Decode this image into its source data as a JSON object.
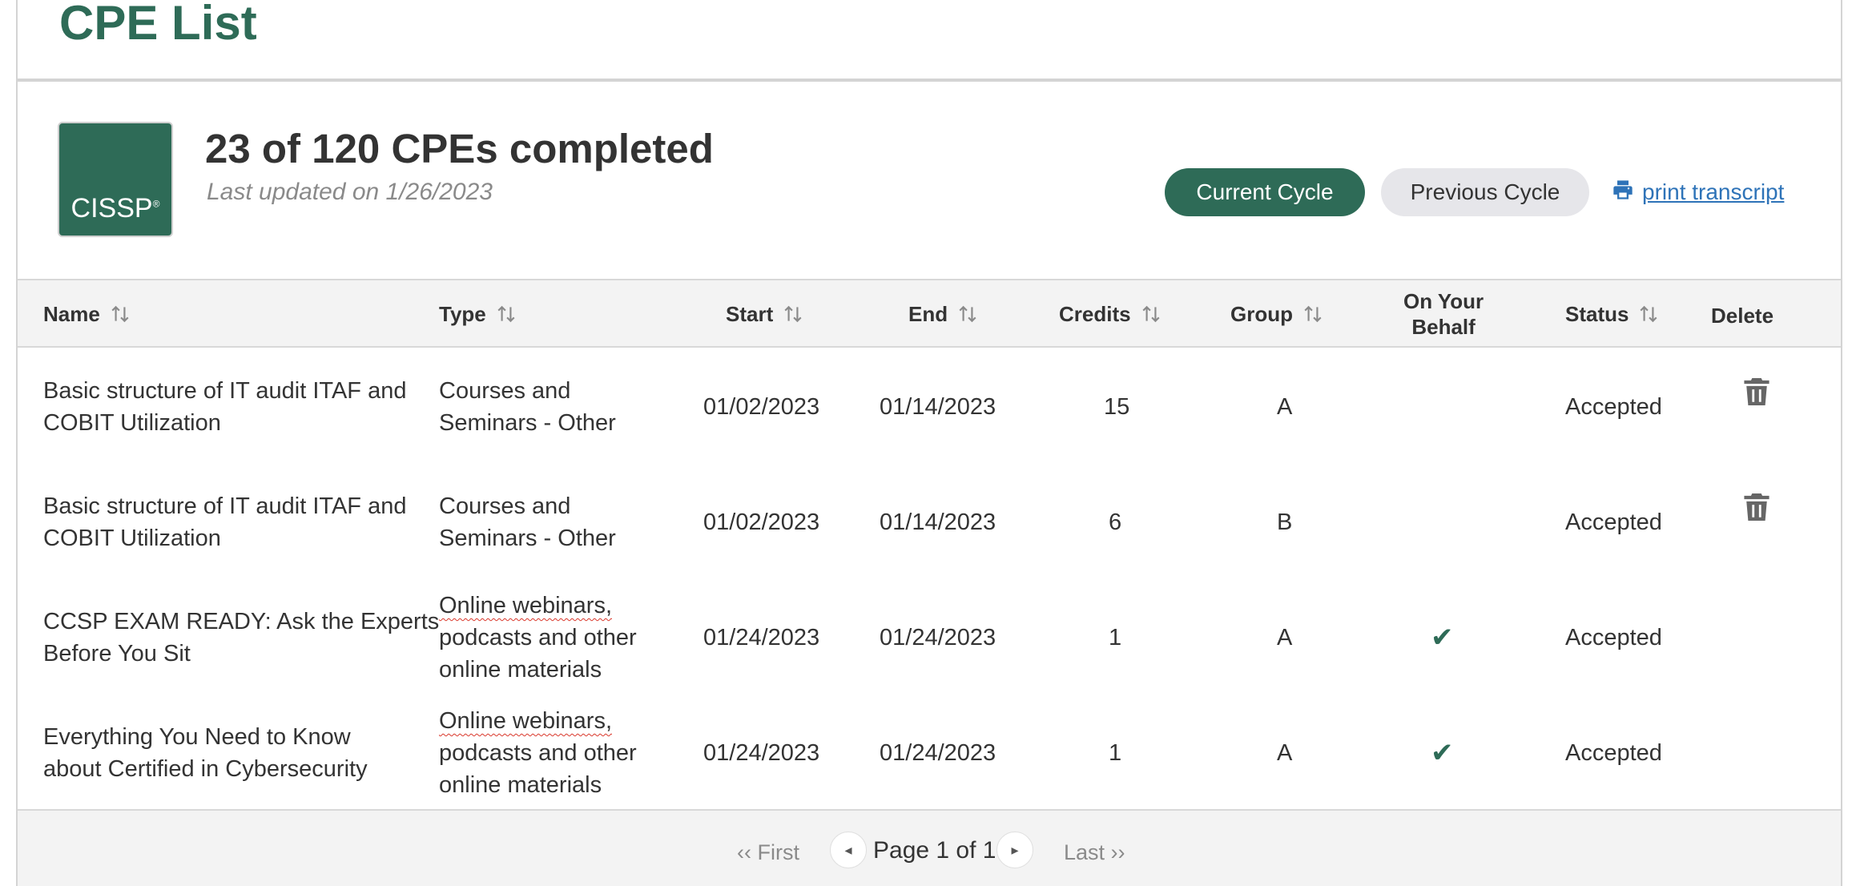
{
  "page": {
    "title": "CPE List"
  },
  "summary": {
    "logo_text": "CISSP",
    "logo_mark": "®",
    "title": "23 of 120 CPEs completed",
    "updated": "Last updated on 1/26/2023"
  },
  "actions": {
    "current_cycle": "Current Cycle",
    "previous_cycle": "Previous Cycle",
    "print_transcript": "print transcript"
  },
  "table": {
    "headers": {
      "name": "Name",
      "type": "Type",
      "start": "Start",
      "end": "End",
      "credits": "Credits",
      "group": "Group",
      "on_your_behalf_1": "On Your",
      "on_your_behalf_2": "Behalf",
      "status": "Status",
      "delete": "Delete"
    },
    "rows": [
      {
        "name_1": "Basic structure of IT audit ITAF and",
        "name_2": "COBIT Utilization",
        "type_1": "Courses and",
        "type_2": "Seminars - Other",
        "type_3": "",
        "start": "01/02/2023",
        "end": "01/14/2023",
        "credits": "15",
        "group": "A",
        "on_your_behalf": "",
        "status": "Accepted",
        "deletable": true
      },
      {
        "name_1": "Basic structure of IT audit ITAF and",
        "name_2": "COBIT Utilization",
        "type_1": "Courses and",
        "type_2": "Seminars - Other",
        "type_3": "",
        "start": "01/02/2023",
        "end": "01/14/2023",
        "credits": "6",
        "group": "B",
        "on_your_behalf": "",
        "status": "Accepted",
        "deletable": true
      },
      {
        "name_1": "CCSP EXAM READY: Ask the Experts",
        "name_2": "Before You Sit",
        "type_1": "Online webinars,",
        "type_2": "podcasts and other",
        "type_3": "online materials",
        "start": "01/24/2023",
        "end": "01/24/2023",
        "credits": "1",
        "group": "A",
        "on_your_behalf": "✔",
        "status": "Accepted",
        "deletable": false
      },
      {
        "name_1": "Everything You Need to Know",
        "name_2": "about Certified in Cybersecurity",
        "type_1": "Online webinars,",
        "type_2": "podcasts and other",
        "type_3": "online materials",
        "start": "01/24/2023",
        "end": "01/24/2023",
        "credits": "1",
        "group": "A",
        "on_your_behalf": "✔",
        "status": "Accepted",
        "deletable": false
      }
    ]
  },
  "pagination": {
    "first": "‹‹ First",
    "prev_icon": "caret-left-icon",
    "label": "Page 1 of 1",
    "next_icon": "caret-right-icon",
    "last": "Last ››"
  },
  "colors": {
    "brand_green": "#2e6b57",
    "link_blue": "#2e73b8",
    "muted": "#8a8a8a"
  }
}
